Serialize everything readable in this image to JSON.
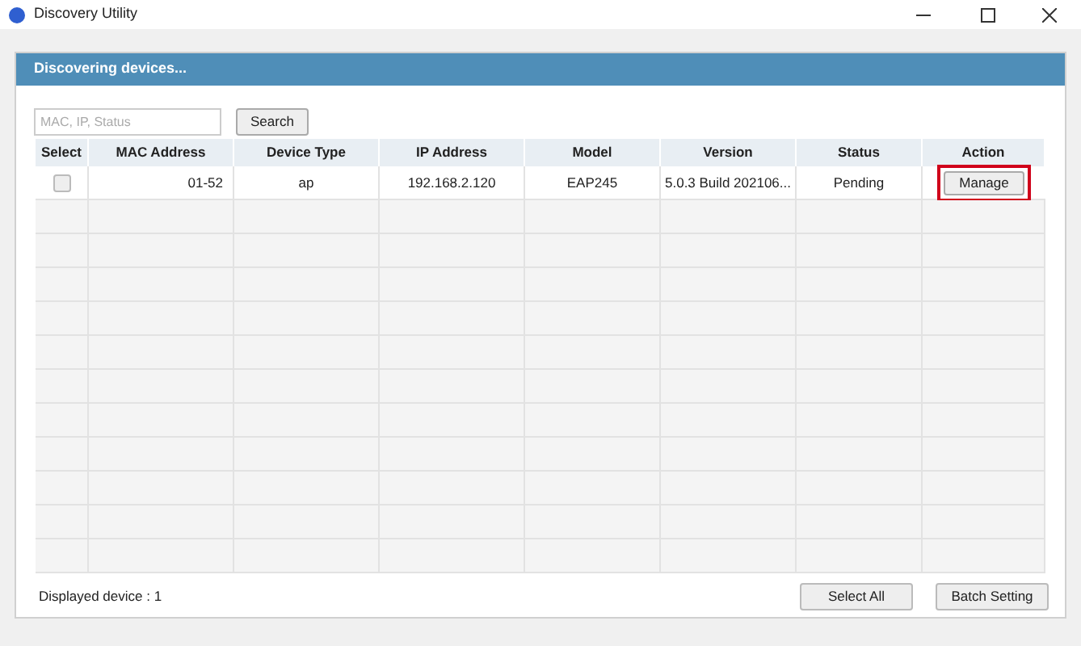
{
  "window": {
    "title": "Discovery Utility"
  },
  "panel": {
    "title": "Discovering devices..."
  },
  "search": {
    "placeholder": "MAC, IP, Status",
    "button": "Search"
  },
  "table": {
    "columns": [
      "Select",
      "MAC Address",
      "Device Type",
      "IP Address",
      "Model",
      "Version",
      "Status",
      "Action"
    ],
    "rows": [
      {
        "checked": false,
        "mac": "01-52",
        "device_type": "ap",
        "ip": "192.168.2.120",
        "model": "EAP245",
        "version": "5.0.3 Build 202106...",
        "status": "Pending",
        "action": "Manage",
        "highlighted": true
      }
    ]
  },
  "footer": {
    "count": "Displayed device : 1",
    "buttons": [
      "Select All",
      "Batch Setting"
    ]
  }
}
